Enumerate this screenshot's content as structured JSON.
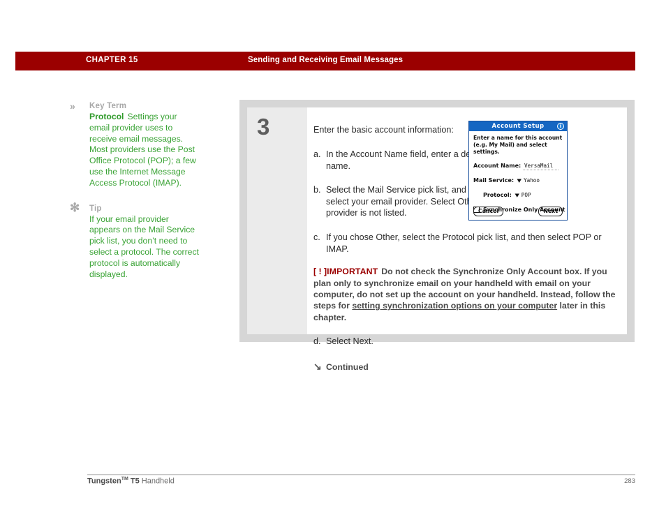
{
  "header": {
    "chapter": "CHAPTER 15",
    "title": "Sending and Receiving Email Messages",
    "bar_color": "#9b0000"
  },
  "sidebar": {
    "blocks": [
      {
        "icon": "double-chevron-icon",
        "icon_glyph": "»",
        "label": "Key Term",
        "term": "Protocol",
        "body": "Settings your email provider uses to receive email messages. Most providers use the Post Office Protocol (POP); a few use the Internet Message Access Protocol (IMAP).",
        "text_color": "#3aa335"
      },
      {
        "icon": "asterisk-icon",
        "icon_glyph": "✻",
        "label": "Tip",
        "term": "",
        "body": "If your email provider appears on the Mail Service pick list, you don’t need to select a protocol. The correct protocol is automatically displayed.",
        "text_color": "#3aa335"
      }
    ]
  },
  "main": {
    "step_number": "3",
    "intro": "Enter the basic account information:",
    "substeps": [
      {
        "marker": "a.",
        "text": "In the Account Name field, enter a descriptive name."
      },
      {
        "marker": "b.",
        "text": "Select the Mail Service pick list, and then select your email provider. Select Other if your provider is not listed."
      },
      {
        "marker": "c.",
        "text": "If you chose Other, select the Protocol pick list, and then select POP or IMAP."
      }
    ],
    "important": {
      "bracket": "[ ! ]",
      "label": "IMPORTANT",
      "text_before": "Do not check the Synchronize Only Account box. If you plan only to synchronize email on your handheld with email on your computer, do not set up the account on your handheld. Instead, follow the steps for ",
      "link_text": "setting synchronization options on your computer",
      "text_after": " later in this chapter.",
      "accent_color": "#9b0000"
    },
    "final_step": {
      "marker": "d.",
      "text": "Select Next."
    },
    "continued": {
      "arrow": "↘",
      "label": "Continued"
    }
  },
  "pda": {
    "title": "Account Setup",
    "info_icon": "info-icon",
    "info_glyph": "i",
    "description": "Enter a name for this account (e.g. My Mail) and select settings.",
    "fields": [
      {
        "label": "Account Name:",
        "value": "VersaMail",
        "has_picker": false
      },
      {
        "label": "Mail Service:",
        "value": "Yahoo",
        "has_picker": true
      },
      {
        "label": "Protocol:",
        "value": "POP",
        "has_picker": true
      }
    ],
    "checkbox": {
      "label": "Synchronize Only Account",
      "checked": false
    },
    "buttons": {
      "cancel": "Cancel",
      "next": "Next"
    },
    "title_bar_color": "#1566c2"
  },
  "footer": {
    "brand": "Tungsten",
    "trademark": "TM",
    "model": " T5",
    "product": " Handheld",
    "page": "283"
  }
}
